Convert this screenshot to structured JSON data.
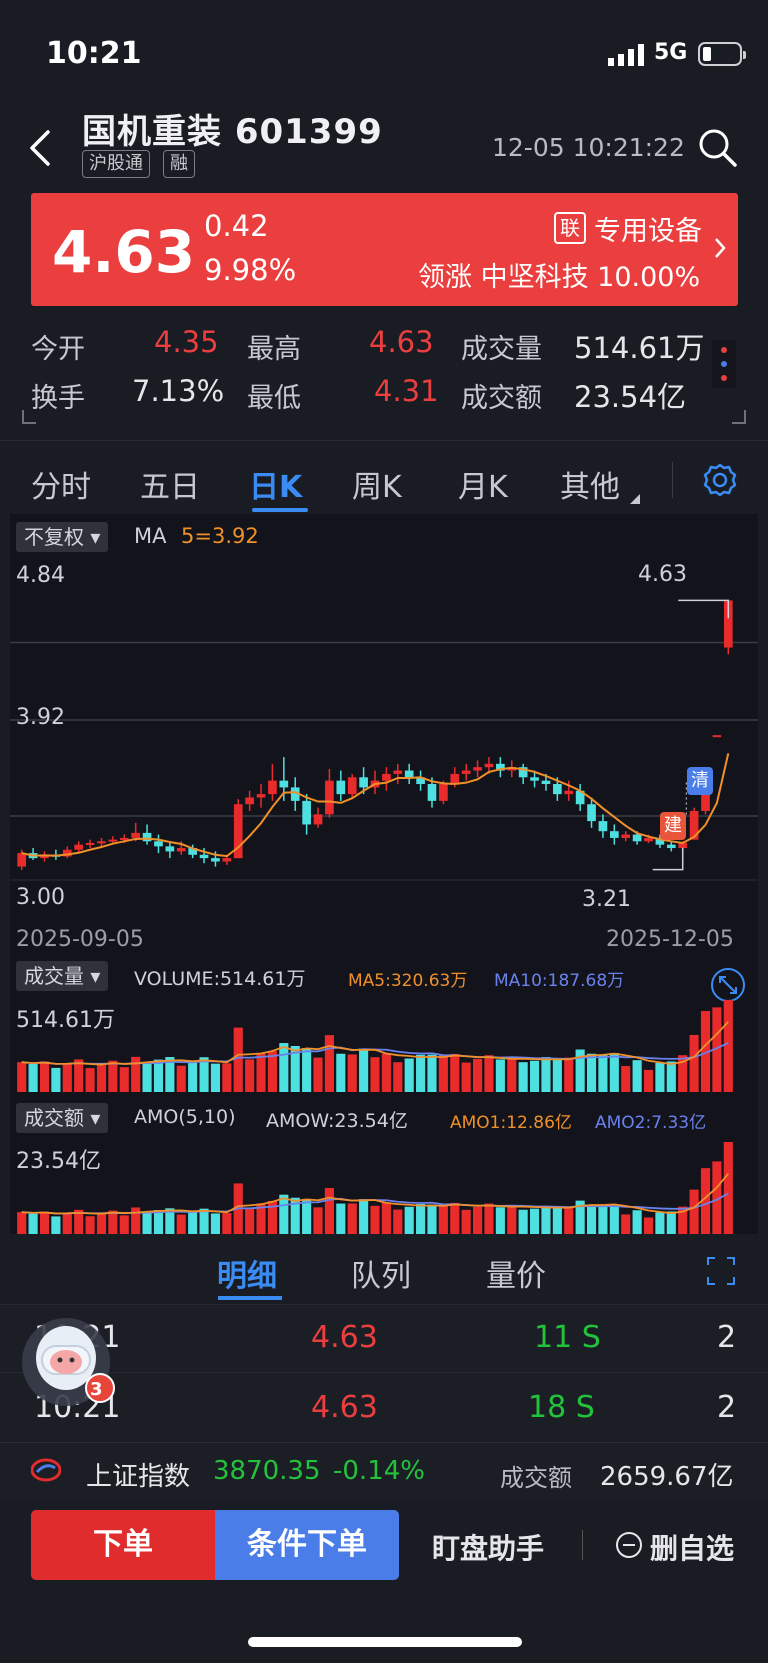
{
  "status_bar": {
    "time": "10:21",
    "network": "5G"
  },
  "header": {
    "stock_name": "国机重装 601399",
    "tags": [
      "沪股通",
      "融"
    ],
    "timestamp": "12-05 10:21:22"
  },
  "quote": {
    "price": "4.63",
    "change": "0.42",
    "change_pct": "9.98%",
    "sector_badge": "联",
    "sector": "专用设备",
    "leader_text": "领涨 中坚科技 10.00%"
  },
  "stats": [
    {
      "label": "今开",
      "value": "4.35",
      "color": "#ea3f3e"
    },
    {
      "label": "最高",
      "value": "4.63",
      "color": "#ea3f3e"
    },
    {
      "label": "成交量",
      "value": "514.61万",
      "color": "#e6e6ea"
    },
    {
      "label": "换手",
      "value": "7.13%",
      "color": "#e6e6ea"
    },
    {
      "label": "最低",
      "value": "4.31",
      "color": "#ea3f3e"
    },
    {
      "label": "成交额",
      "value": "23.54亿",
      "color": "#e6e6ea"
    }
  ],
  "period_tabs": [
    "分时",
    "五日",
    "日K",
    "周K",
    "月K",
    "其他"
  ],
  "period_active": 2,
  "chart": {
    "fq_label": "不复权",
    "ma_label": "MA",
    "ma5_text": "5=3.92",
    "y_labels": [
      "4.84",
      "3.92",
      "3.00"
    ],
    "high_marker": "4.63",
    "low_marker": "3.21",
    "marker_build": "建",
    "marker_clear": "清",
    "date_start": "2025-09-05",
    "date_end": "2025-12-05",
    "vol_label": "成交量",
    "vol_text": "VOLUME:514.61万",
    "vol_ma5": "MA5:320.63万",
    "vol_ma10": "MA10:187.68万",
    "vol_max": "514.61万",
    "amo_label": "成交额",
    "amo_text": "AMO(5,10)",
    "amow_text": "AMOW:23.54亿",
    "amo1": "AMO1:12.86亿",
    "amo2": "AMO2:7.33亿",
    "amo_max": "23.54亿"
  },
  "chart_data": {
    "type": "candlestick",
    "x_range": [
      "2025-09-05",
      "2025-12-05"
    ],
    "ylim": [
      3.0,
      4.84
    ],
    "ma5_last": 3.92,
    "high": 4.63,
    "low": 3.21,
    "candles": [
      [
        3.05,
        3.15,
        3.13,
        3.03
      ],
      [
        3.13,
        3.16,
        3.1,
        3.09
      ],
      [
        3.1,
        3.14,
        3.12,
        3.08
      ],
      [
        3.12,
        3.15,
        3.11,
        3.09
      ],
      [
        3.11,
        3.17,
        3.15,
        3.1
      ],
      [
        3.15,
        3.2,
        3.18,
        3.13
      ],
      [
        3.18,
        3.21,
        3.19,
        3.16
      ],
      [
        3.19,
        3.22,
        3.2,
        3.17
      ],
      [
        3.2,
        3.23,
        3.21,
        3.18
      ],
      [
        3.21,
        3.24,
        3.22,
        3.19
      ],
      [
        3.22,
        3.31,
        3.25,
        3.2
      ],
      [
        3.25,
        3.3,
        3.2,
        3.18
      ],
      [
        3.2,
        3.24,
        3.17,
        3.13
      ],
      [
        3.17,
        3.2,
        3.14,
        3.1
      ],
      [
        3.14,
        3.2,
        3.16,
        3.12
      ],
      [
        3.16,
        3.18,
        3.12,
        3.1
      ],
      [
        3.12,
        3.16,
        3.1,
        3.07
      ],
      [
        3.1,
        3.14,
        3.08,
        3.05
      ],
      [
        3.08,
        3.12,
        3.1,
        3.06
      ],
      [
        3.1,
        3.45,
        3.42,
        3.1
      ],
      [
        3.42,
        3.5,
        3.46,
        3.38
      ],
      [
        3.46,
        3.54,
        3.48,
        3.4
      ],
      [
        3.48,
        3.66,
        3.56,
        3.44
      ],
      [
        3.56,
        3.7,
        3.52,
        3.44
      ],
      [
        3.52,
        3.58,
        3.44,
        3.38
      ],
      [
        3.44,
        3.48,
        3.3,
        3.24
      ],
      [
        3.3,
        3.4,
        3.36,
        3.28
      ],
      [
        3.36,
        3.63,
        3.56,
        3.34
      ],
      [
        3.56,
        3.62,
        3.48,
        3.44
      ],
      [
        3.48,
        3.6,
        3.58,
        3.46
      ],
      [
        3.58,
        3.64,
        3.52,
        3.48
      ],
      [
        3.52,
        3.62,
        3.56,
        3.48
      ],
      [
        3.56,
        3.64,
        3.6,
        3.5
      ],
      [
        3.6,
        3.66,
        3.62,
        3.54
      ],
      [
        3.62,
        3.66,
        3.58,
        3.54
      ],
      [
        3.58,
        3.62,
        3.54,
        3.5
      ],
      [
        3.54,
        3.58,
        3.44,
        3.4
      ],
      [
        3.44,
        3.56,
        3.54,
        3.42
      ],
      [
        3.54,
        3.64,
        3.6,
        3.52
      ],
      [
        3.6,
        3.66,
        3.62,
        3.56
      ],
      [
        3.62,
        3.68,
        3.64,
        3.58
      ],
      [
        3.64,
        3.7,
        3.66,
        3.6
      ],
      [
        3.66,
        3.7,
        3.62,
        3.58
      ],
      [
        3.62,
        3.68,
        3.64,
        3.58
      ],
      [
        3.64,
        3.66,
        3.58,
        3.54
      ],
      [
        3.58,
        3.62,
        3.56,
        3.52
      ],
      [
        3.56,
        3.6,
        3.54,
        3.5
      ],
      [
        3.54,
        3.58,
        3.48,
        3.44
      ],
      [
        3.48,
        3.56,
        3.5,
        3.44
      ],
      [
        3.5,
        3.54,
        3.42,
        3.38
      ],
      [
        3.42,
        3.46,
        3.32,
        3.28
      ],
      [
        3.32,
        3.36,
        3.26,
        3.22
      ],
      [
        3.26,
        3.3,
        3.22,
        3.18
      ],
      [
        3.22,
        3.26,
        3.24,
        3.2
      ],
      [
        3.24,
        3.26,
        3.2,
        3.18
      ],
      [
        3.2,
        3.24,
        3.22,
        3.19
      ],
      [
        3.22,
        3.24,
        3.18,
        3.16
      ],
      [
        3.18,
        3.2,
        3.16,
        3.14
      ],
      [
        3.16,
        3.2,
        3.19,
        3.14
      ],
      [
        3.21,
        3.4,
        3.38,
        3.21
      ],
      [
        3.38,
        3.62,
        3.58,
        3.36
      ],
      [
        3.83,
        3.83,
        3.83,
        3.83
      ],
      [
        4.35,
        4.63,
        4.63,
        4.31
      ]
    ]
  },
  "lower_tabs": [
    "明细",
    "队列",
    "量价"
  ],
  "ticks": [
    {
      "time": "10:21",
      "price": "4.63",
      "vol": "11 S",
      "n": "2"
    },
    {
      "time": "10:21",
      "price": "4.63",
      "vol": "18 S",
      "n": "2"
    }
  ],
  "assistant_badge": "3",
  "index_bar": {
    "name": "上证指数",
    "value": "3870.35",
    "change": "-0.14%",
    "turnover_label": "成交额",
    "turnover": "2659.67亿"
  },
  "actions": {
    "buy": "下单",
    "cond": "条件下单",
    "helper": "盯盘助手",
    "delete": "删自选"
  }
}
